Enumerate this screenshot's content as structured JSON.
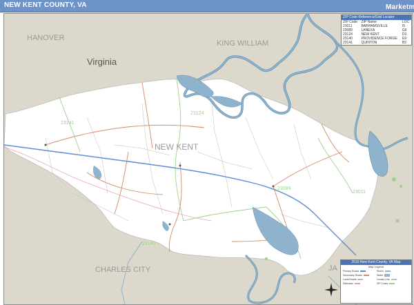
{
  "title": "NEW KENT COUNTY, VA",
  "logo_text": "Marketmaps",
  "labels": {
    "hanover": "HANOVER",
    "king_william": "KING WILLIAM",
    "virginia": "Virginia",
    "new_kent": "NEW KENT",
    "charles_city": "CHARLES CITY",
    "james_city": "JA"
  },
  "zip_labels": [
    "23141",
    "23124",
    "23089",
    "23011",
    "23140"
  ],
  "zip_table": {
    "header": "ZIP Code Reference/Grid Locator",
    "columns": [
      "ZIP Code",
      "ZIP Name",
      "LOC"
    ],
    "rows": [
      [
        "23011",
        "BARHAMSVILLE",
        "I5"
      ],
      [
        "23089",
        "LANEXA",
        "G6"
      ],
      [
        "23124",
        "NEW KENT",
        "D3"
      ],
      [
        "23140",
        "PROVIDENCE FORGE",
        "E9"
      ],
      [
        "23141",
        "QUINTON",
        "B3"
      ]
    ]
  },
  "legend": {
    "title": "2016 New Kent County, VA Map",
    "subtitle": "Map Legend",
    "items": [
      "Primary Roads",
      "Secondary Roads",
      "Local Roads",
      "Railroads",
      "Rivers",
      "Water",
      "County Line",
      "ZIP Codes"
    ]
  },
  "colors": {
    "county": "#ffffff",
    "outside": "#ddd8cc",
    "water": "#8fb3cc",
    "water_edge": "#5f8fb0",
    "interstate": "#5b8dd6",
    "road": "#d28a6a",
    "zip_boundary": "#9cd18c",
    "title_bar": "#6d93c9"
  }
}
